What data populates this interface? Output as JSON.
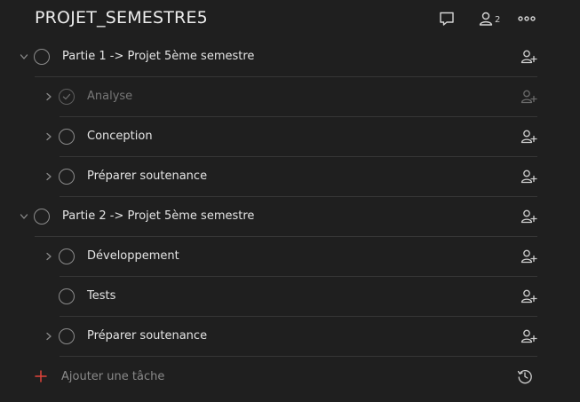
{
  "header": {
    "title": "PROJET_SEMESTRE5",
    "comment_icon": "comment-icon",
    "members_icon": "person-icon",
    "members_count": "2",
    "more_icon": "ellipsis-icon"
  },
  "colors": {
    "background": "#1f1f1f",
    "divider": "#363636",
    "text": "#e4e4e4",
    "muted_text": "#777777",
    "add_plus": "#e0433a"
  },
  "tasks": [
    {
      "label": "Partie 1 -> Projet 5ème semestre",
      "level": 0,
      "expanded": true,
      "completed": false
    },
    {
      "label": "Analyse",
      "level": 1,
      "expanded": false,
      "completed": true
    },
    {
      "label": "Conception",
      "level": 1,
      "expanded": false,
      "completed": false
    },
    {
      "label": "Préparer soutenance",
      "level": 1,
      "expanded": false,
      "completed": false
    },
    {
      "label": "Partie 2 -> Projet 5ème semestre",
      "level": 0,
      "expanded": true,
      "completed": false
    },
    {
      "label": "Développement",
      "level": 1,
      "expanded": false,
      "completed": false
    },
    {
      "label": "Tests",
      "level": 1,
      "expanded": false,
      "completed": false,
      "no_subtasks": true
    },
    {
      "label": "Préparer soutenance",
      "level": 1,
      "expanded": false,
      "completed": false
    }
  ],
  "add_task": {
    "label": "Ajouter une tâche",
    "plus_icon": "plus-icon",
    "history_icon": "history-icon"
  }
}
